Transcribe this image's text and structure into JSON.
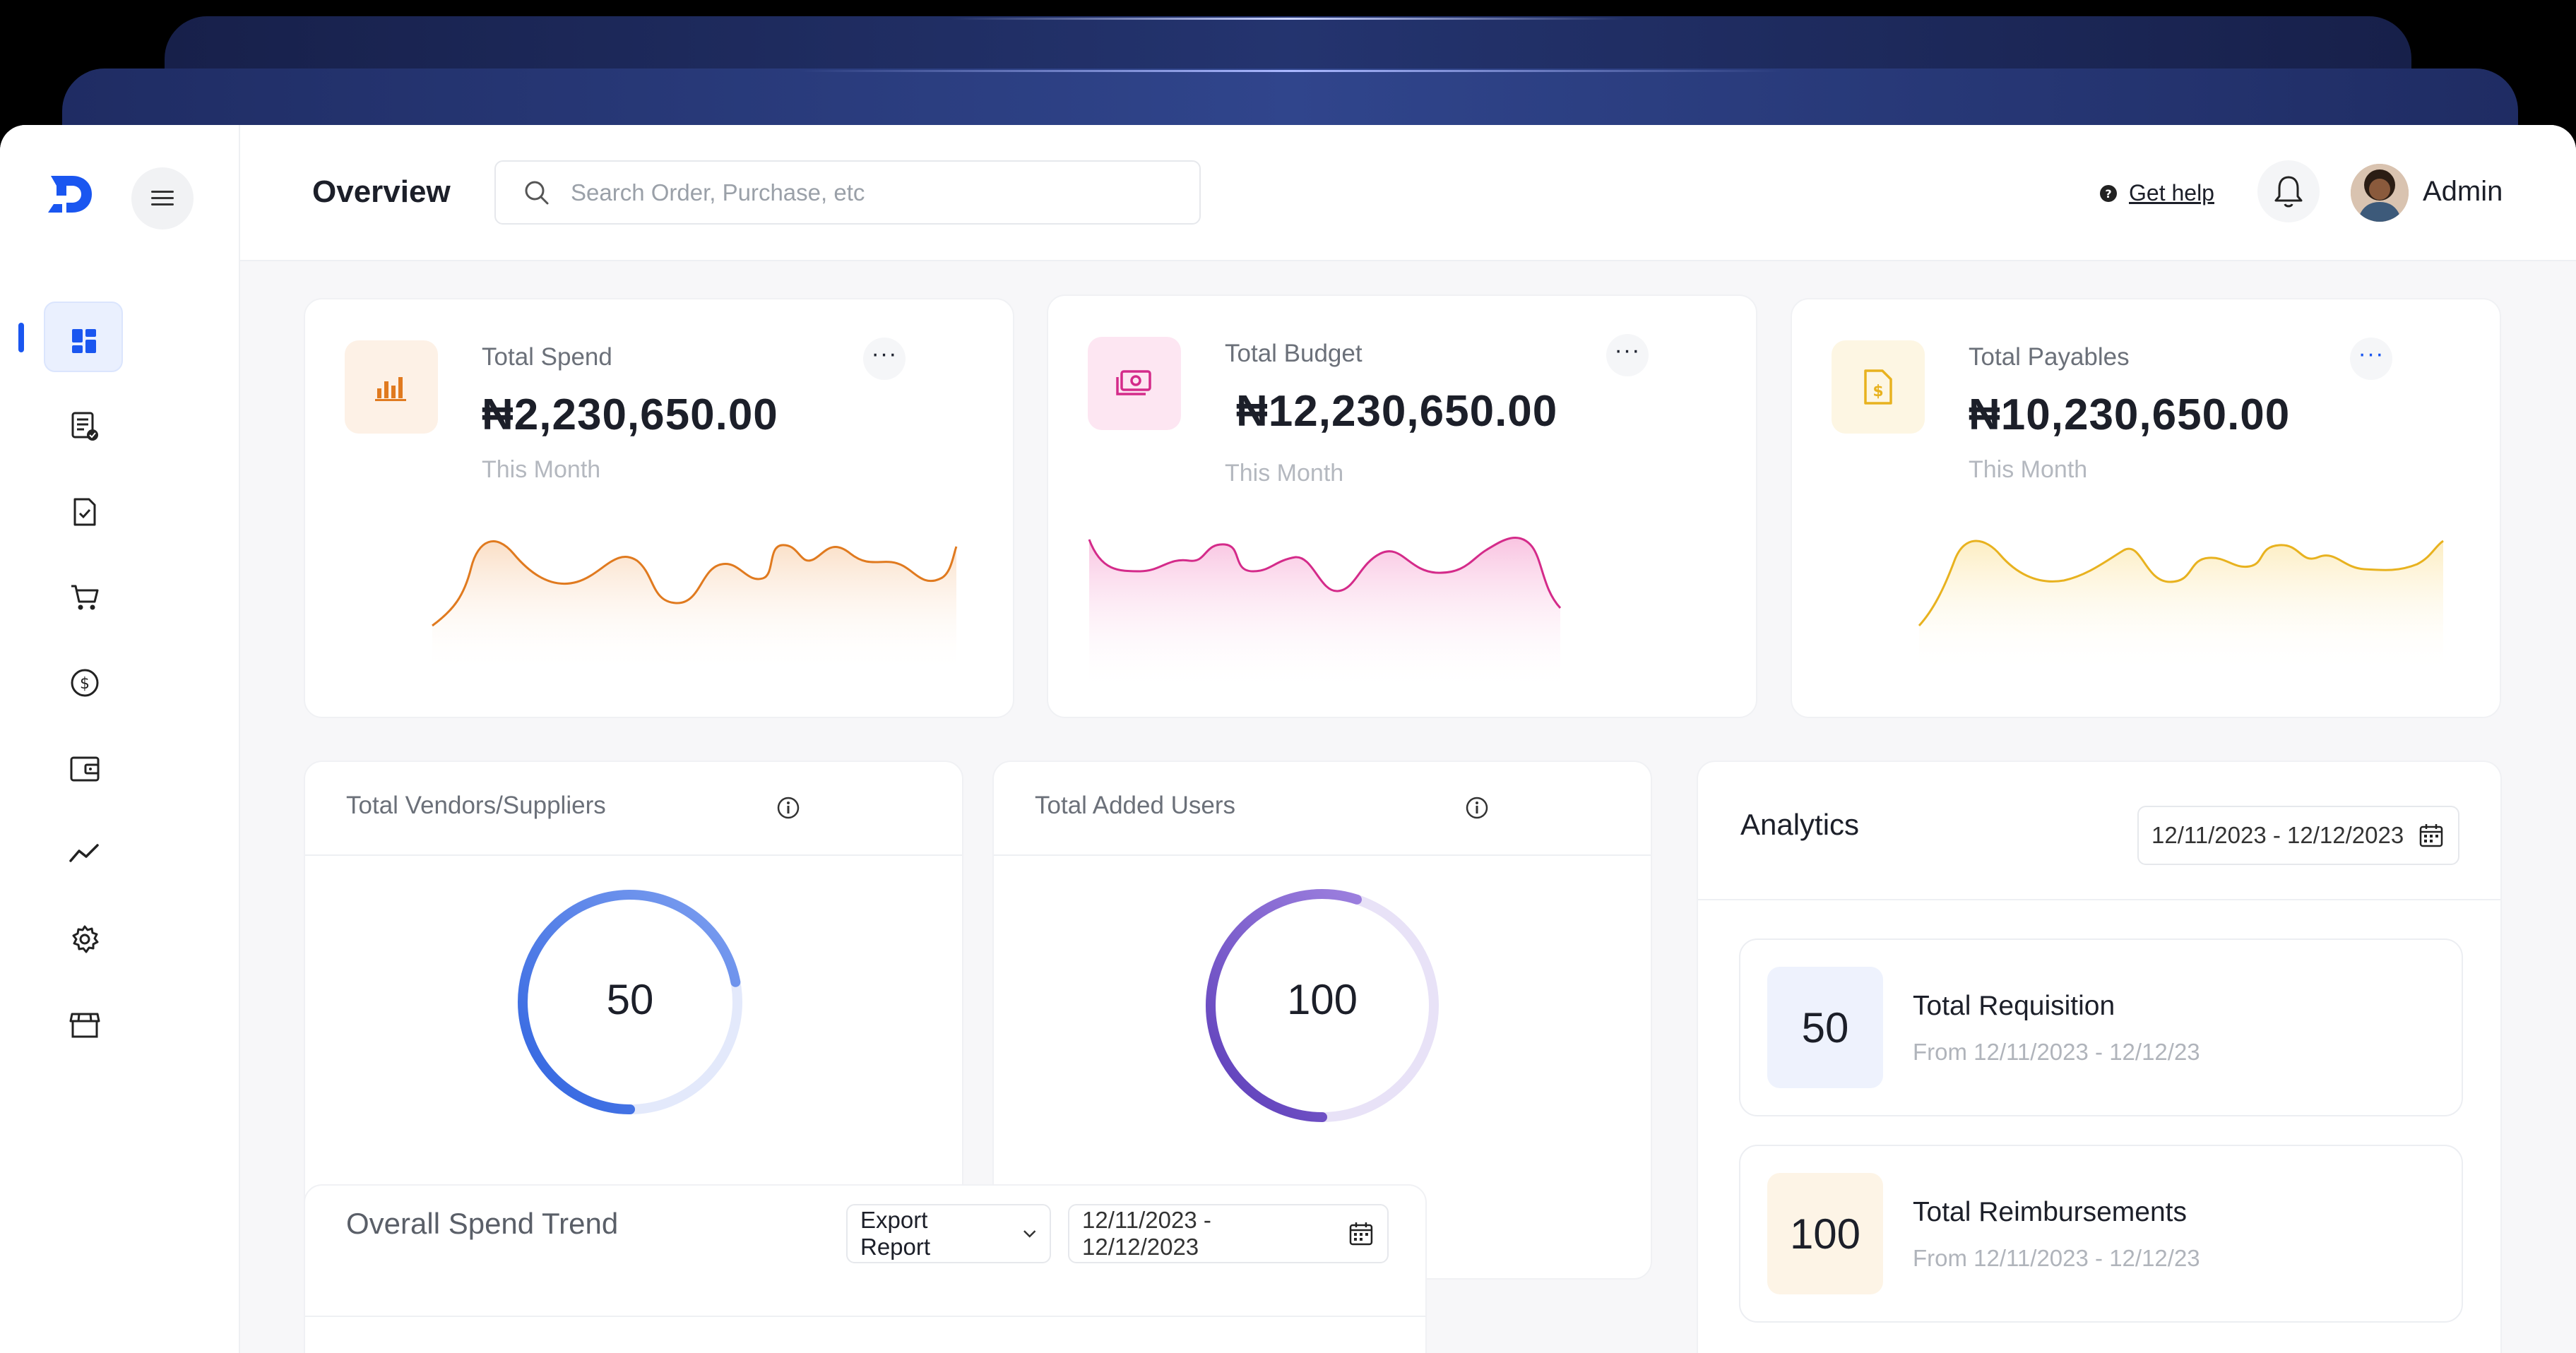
{
  "app": {
    "brand_color": "#1a56f0"
  },
  "header": {
    "title": "Overview",
    "search_placeholder": "Search Order, Purchase, etc",
    "help_label": "Get help",
    "user_name": "Admin"
  },
  "sidebar": {
    "items": [
      {
        "icon": "dashboard-icon",
        "active": true
      },
      {
        "icon": "requisition-icon"
      },
      {
        "icon": "approval-document-icon"
      },
      {
        "icon": "cart-icon"
      },
      {
        "icon": "dollar-icon"
      },
      {
        "icon": "wallet-icon"
      },
      {
        "icon": "trend-icon"
      },
      {
        "icon": "settings-icon"
      },
      {
        "icon": "store-icon"
      }
    ]
  },
  "kpis": [
    {
      "label": "Total Spend",
      "value": "₦2,230,650.00",
      "period": "This Month",
      "color": "#e07a1f"
    },
    {
      "label": "Total Budget",
      "value": "₦12,230,650.00",
      "period": "This Month",
      "color": "#d42b8a"
    },
    {
      "label": "Total Payables",
      "value": "₦10,230,650.00",
      "period": "This Month",
      "color": "#e8b21f"
    }
  ],
  "stats": {
    "vendors": {
      "title": "Total Vendors/Suppliers",
      "value": "50",
      "progress": 0.72,
      "color": "#3a6ee8"
    },
    "users": {
      "title": "Total Added Users",
      "value": "100",
      "progress": 0.55,
      "color": "#6c4fc4"
    }
  },
  "analytics": {
    "title": "Analytics",
    "date_range": "12/11/2023 - 12/12/2023",
    "items": [
      {
        "value": "50",
        "label": "Total Requisition",
        "range": "From 12/11/2023 - 12/12/23",
        "bg": "#eef2fd"
      },
      {
        "value": "100",
        "label": "Total Reimbursements",
        "range": "From 12/11/2023 - 12/12/23",
        "bg": "#fdf4e6"
      }
    ]
  },
  "trend": {
    "title": "Overall Spend Trend",
    "export_label": "Export Report",
    "date_range": "12/11/2023 - 12/12/2023"
  }
}
